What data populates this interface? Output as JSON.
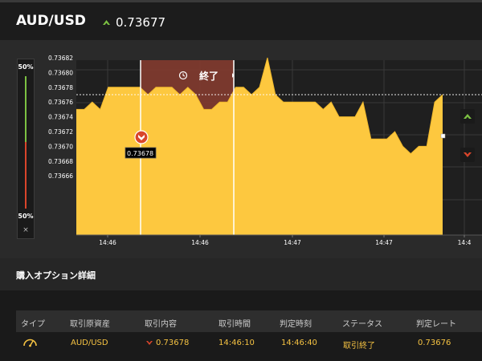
{
  "header": {
    "symbol": "AUD/USD",
    "price": "0.73677",
    "trend": "up"
  },
  "chart_data": {
    "type": "area",
    "y_ticks": [
      "0.73682",
      "0.73680",
      "0.73678",
      "0.73676",
      "0.73674",
      "0.73672",
      "0.73670",
      "0.73668",
      "0.73666"
    ],
    "x_ticks": [
      "14:46",
      "14:46",
      "14:47",
      "14:47",
      "14:4"
    ],
    "ylim": [
      0.73665,
      0.73685
    ],
    "series": [
      {
        "values": [
          0.73675,
          0.73675,
          0.73676,
          0.73675,
          0.73678,
          0.73678,
          0.73678,
          0.73678,
          0.73678,
          0.73677,
          0.73678,
          0.73678,
          0.73678,
          0.73677,
          0.73678,
          0.73677,
          0.73675,
          0.73675,
          0.73676,
          0.73676,
          0.73678,
          0.73678,
          0.73677,
          0.73678,
          0.73682,
          0.73677,
          0.73676,
          0.73676,
          0.73676,
          0.73676,
          0.73676,
          0.73675,
          0.73676,
          0.73674,
          0.73674,
          0.73674,
          0.73676,
          0.73671,
          0.73671,
          0.73671,
          0.73672,
          0.7367,
          0.73669,
          0.7367,
          0.7367,
          0.73676,
          0.73677
        ]
      }
    ],
    "entry_label": "0.73678",
    "expiry_label": "終了",
    "reference_line": 0.73677,
    "grid": true
  },
  "gauge": {
    "top_label": "50%",
    "bottom_label": "50%",
    "close_label": "×",
    "up_color": "#7cc142",
    "down_color": "#d9452b"
  },
  "section": {
    "title": "購入オプション詳細"
  },
  "table": {
    "headers": [
      "タイプ",
      "取引原資産",
      "取引内容",
      "取引時間",
      "判定時刻",
      "ステータス",
      "判定レート"
    ],
    "row": {
      "type_icon": "speedometer-icon",
      "asset": "AUD/USD",
      "direction": "down",
      "content_rate": "0.73678",
      "trade_time": "14:46:10",
      "judge_time": "14:46:40",
      "status": "取引終了",
      "judge_rate": "0.73676"
    }
  },
  "colors": {
    "area_fill": "#fdc83f",
    "expired_zone": "#7e3a2e",
    "up": "#7cc142",
    "down": "#d9452b",
    "table_text": "#f5c242"
  }
}
